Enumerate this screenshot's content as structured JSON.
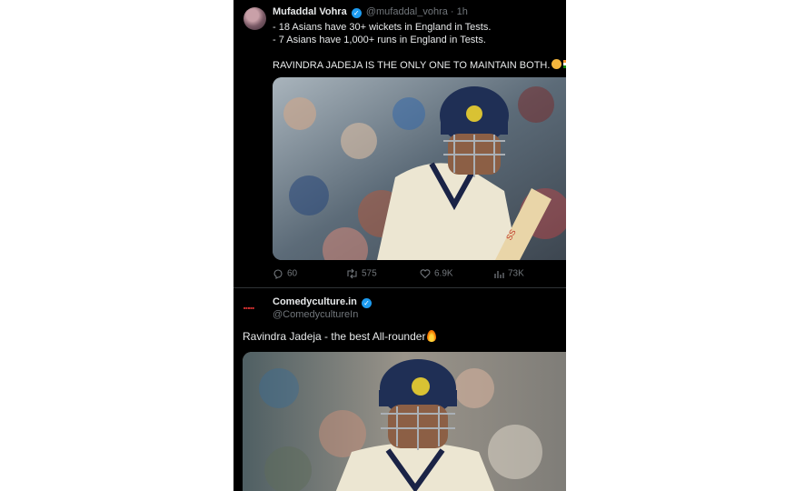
{
  "tweet1": {
    "name": "Mufaddal Vohra",
    "handle": "@mufaddal_vohra · 1h",
    "lines": [
      "- 18 Asians have 30+ wickets in England in Tests.",
      "- 7 Asians have 1,000+ runs in England in Tests.",
      "RAVINDRA JADEJA IS THE ONLY ONE TO MAINTAIN BOTH."
    ],
    "emojis": [
      "face-with-hat-emoji",
      "india-flag-emoji"
    ],
    "photo_alt": "cricketer-in-blue-helmet-photo",
    "stats": {
      "replies": "60",
      "retweets": "575",
      "likes": "6.9K",
      "views": "73K"
    }
  },
  "tweet2": {
    "name": "Comedyculture.in",
    "handle": "@ComedycultureIn",
    "text": "Ravindra Jadeja - the best All-rounder",
    "emoji": "fire-emoji",
    "photo_alt": "cricketer-in-blue-helmet-photo"
  },
  "colors": {
    "background": "#000000",
    "text": "#e7e9ea",
    "muted": "#71767b",
    "verified": "#1d9bf0"
  }
}
